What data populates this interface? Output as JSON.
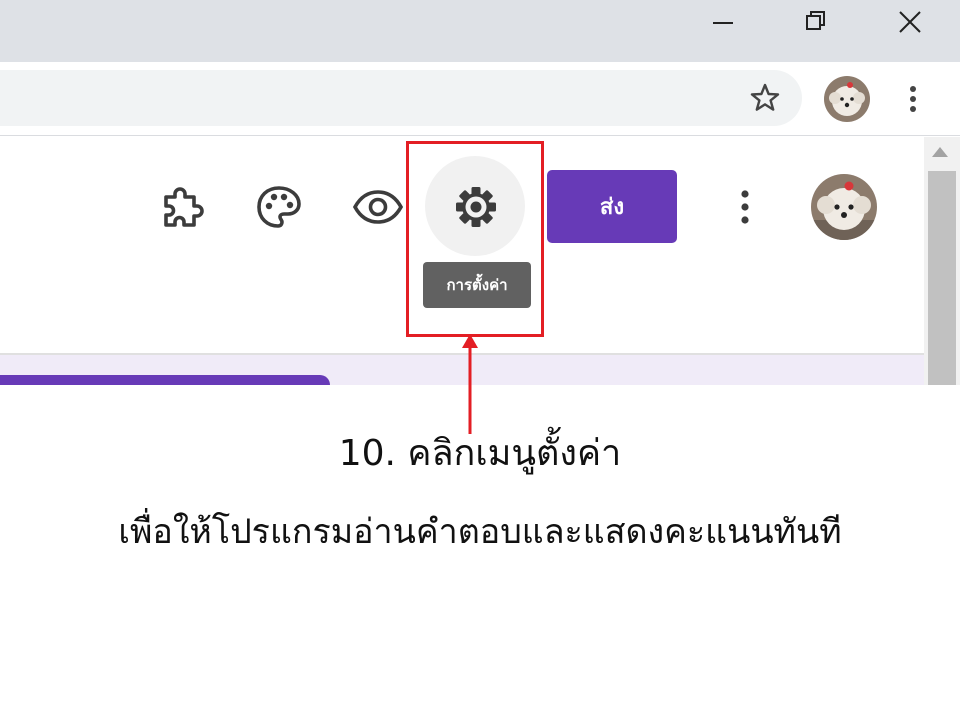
{
  "window_controls": {
    "minimize": "minimize-icon",
    "restore": "restore-icon",
    "close": "close-icon"
  },
  "browser_toolbar": {
    "bookmark_icon": "star-icon",
    "profile_icon": "profile-avatar",
    "menu_icon": "more-vert-icon"
  },
  "forms_header": {
    "icons": [
      "puzzle-addon-icon",
      "palette-icon",
      "eye-preview-icon",
      "gear-icon"
    ],
    "settings_tooltip": "การตั้งค่า",
    "send_label": "ส่ง",
    "more_icon": "more-vert-icon",
    "accent_color": "#673ab7"
  },
  "annotation": {
    "highlight_color": "#e31e24",
    "line1": "10. คลิกเมนูตั้งค่า",
    "line2": "เพื่อให้โปรแกรมอ่านคำตอบและแสดงคะแนนทันที"
  }
}
